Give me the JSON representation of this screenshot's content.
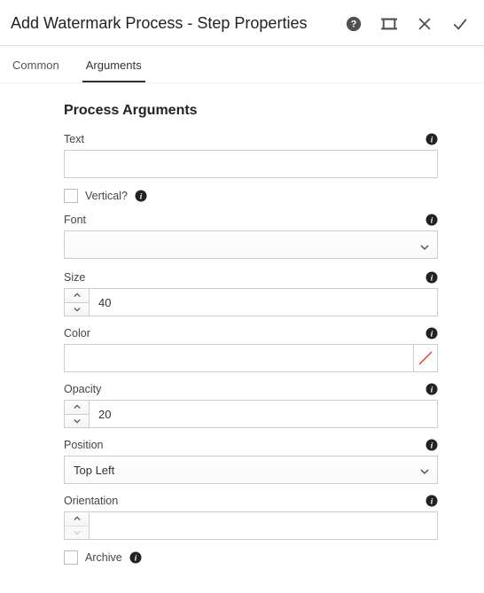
{
  "header": {
    "title": "Add Watermark Process - Step Properties"
  },
  "tabs": {
    "common": "Common",
    "arguments": "Arguments"
  },
  "section": {
    "title": "Process Arguments"
  },
  "fields": {
    "text": {
      "label": "Text",
      "value": ""
    },
    "vertical": {
      "label": "Vertical?"
    },
    "font": {
      "label": "Font",
      "value": ""
    },
    "size": {
      "label": "Size",
      "value": "40"
    },
    "color": {
      "label": "Color",
      "value": ""
    },
    "opacity": {
      "label": "Opacity",
      "value": "20"
    },
    "position": {
      "label": "Position",
      "value": "Top Left"
    },
    "orientation": {
      "label": "Orientation",
      "value": ""
    },
    "archive": {
      "label": "Archive"
    }
  }
}
